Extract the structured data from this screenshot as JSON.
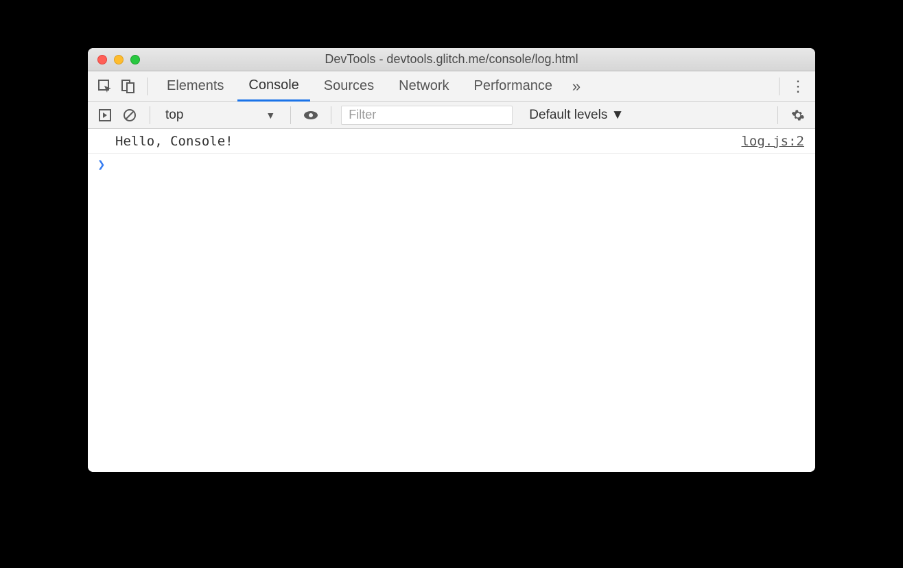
{
  "window": {
    "title": "DevTools - devtools.glitch.me/console/log.html"
  },
  "tabs": {
    "items": [
      "Elements",
      "Console",
      "Sources",
      "Network",
      "Performance"
    ],
    "active": "Console"
  },
  "toolbar": {
    "context": "top",
    "filter_placeholder": "Filter",
    "levels": "Default levels ▼"
  },
  "console": {
    "rows": [
      {
        "message": "Hello, Console!",
        "source": "log.js:2"
      }
    ],
    "prompt": "❯"
  }
}
